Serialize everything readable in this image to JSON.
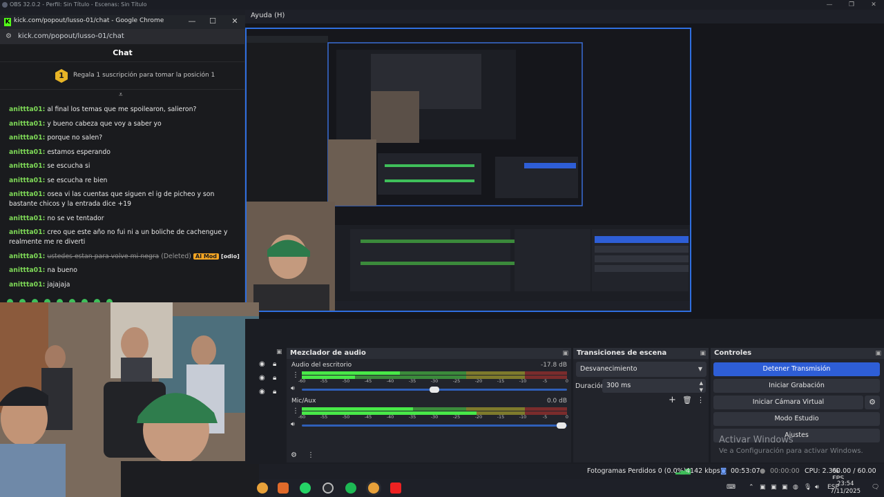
{
  "obs": {
    "title": "OBS 32.0.2 - Perfil: Sin Título - Escenas: Sin Título",
    "menu_help": "Ayuda (H)"
  },
  "chat_window": {
    "title": "kick.com/popout/lusso-01/chat - Google Chrome",
    "url": "kick.com/popout/lusso-01/chat",
    "header": "Chat",
    "promo_rank": "1",
    "promo_text": "Regala 1 suscripción para tomar la posición 1",
    "messages": [
      {
        "user": "anittta01:",
        "text": "al final los temas que me spoilearon, salieron?"
      },
      {
        "user": "anittta01:",
        "text": "y bueno cabeza que voy a saber yo"
      },
      {
        "user": "anittta01:",
        "text": "porque no salen?"
      },
      {
        "user": "anittta01:",
        "text": "estamos esperando"
      },
      {
        "user": "anittta01:",
        "text": "se escucha si"
      },
      {
        "user": "anittta01:",
        "text": "se escucha re bien"
      },
      {
        "user": "anittta01:",
        "text": "osea vi las cuentas que siguen el ig de picheo y son bastante chicos y la entrada dice +19"
      },
      {
        "user": "anittta01:",
        "text": "no se ve tentador"
      },
      {
        "user": "anittta01:",
        "text": "creo que este año no fui ni a un boliche de cachengue y realmente me re diverti"
      },
      {
        "user": "anittta01:",
        "deleted_text": "ustedes estan para volve mi negra",
        "deleted_tag": "(Deleted)",
        "mod_badge": "AI Mod",
        "tag": "[odio]"
      },
      {
        "user": "anittta01:",
        "text": "na bueno"
      },
      {
        "user": "anittta01:",
        "text": "jajajaja"
      }
    ]
  },
  "mixer": {
    "title": "Mezclador de audio",
    "ticks": [
      "-60",
      "-55",
      "-50",
      "-45",
      "-40",
      "-35",
      "-30",
      "-25",
      "-20",
      "-15",
      "-10",
      "-5",
      "0"
    ],
    "channels": [
      {
        "name": "Audio del escritorio",
        "db": "-17.8 dB",
        "level": 0.37,
        "level2": 0.2,
        "volume": 0.5
      },
      {
        "name": "Mic/Aux",
        "db": "0.0 dB",
        "level": 0.42,
        "level2": 0.66,
        "volume": 0.98
      }
    ]
  },
  "transitions": {
    "title": "Transiciones de escena",
    "selected": "Desvanecimiento",
    "duration_label": "Duración",
    "duration_value": "300 ms"
  },
  "controls": {
    "title": "Controles",
    "stop_stream": "Detener Transmisión",
    "start_recording": "Iniciar Grabación",
    "virtual_camera": "Iniciar Cámara Virtual",
    "studio_mode": "Modo Estudio",
    "settings": "Ajustes"
  },
  "windows_activation": {
    "line1": "Activar Windows",
    "line2": "Ve a Configuración para activar Windows."
  },
  "status": {
    "dropped_frames": "Fotogramas Perdidos 0 (0.0%)",
    "bitrate": "4142 kbps",
    "stream_time": "00:53:07",
    "record_time": "00:00:00",
    "cpu": "CPU: 2.3%",
    "fps": "60.00 / 60.00 FPS"
  },
  "taskbar": {
    "lang": "ESP",
    "time": "23:54",
    "date": "7/11/2025"
  },
  "colors": {
    "accent": "#2e5ed6",
    "kick_green": "#53fc18",
    "username": "#7ed957"
  }
}
